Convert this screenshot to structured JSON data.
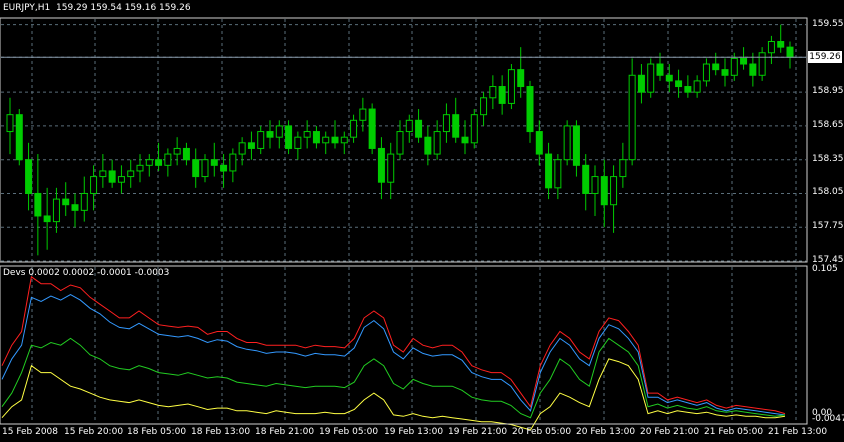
{
  "chart_header": {
    "symbol": "EURJPY,H1",
    "ohlc": "159.29 159.54 159.16 159.26"
  },
  "price_axis": {
    "ticks": [
      "159.55",
      "159.26",
      "158.95",
      "158.65",
      "158.35",
      "158.05",
      "157.75",
      "157.45"
    ],
    "current_price": "159.26"
  },
  "indicator": {
    "header": "Devs 0.0002 0.0002 -0.0001 -0.0003",
    "axis_ticks": [
      "0.105",
      "0.00",
      "-0.0047"
    ]
  },
  "time_axis": {
    "labels": [
      "15 Feb 2008",
      "15 Feb 20:00",
      "18 Feb 05:00",
      "18 Feb 13:00",
      "18 Feb 21:00",
      "19 Feb 05:00",
      "19 Feb 13:00",
      "19 Feb 21:00",
      "20 Feb 05:00",
      "20 Feb 13:00",
      "20 Feb 21:00",
      "21 Feb 05:00",
      "21 Feb 13:00"
    ]
  },
  "colors": {
    "background": "#000000",
    "grid": "#5a6e7a",
    "candle": "#00cc00",
    "price_line": "#8899aa",
    "dev1": "#ff2020",
    "dev2": "#3399ff",
    "dev3": "#22cc22",
    "dev4": "#ffff44"
  },
  "chart_data": {
    "type": "candlestick",
    "ylim": [
      157.45,
      159.6
    ],
    "candles": [
      [
        158.6,
        158.9,
        158.4,
        158.75
      ],
      [
        158.75,
        158.8,
        158.3,
        158.35
      ],
      [
        158.35,
        158.5,
        157.9,
        158.05
      ],
      [
        158.05,
        158.4,
        157.5,
        157.85
      ],
      [
        157.85,
        158.1,
        157.55,
        157.8
      ],
      [
        157.8,
        158.1,
        157.7,
        158.0
      ],
      [
        158.0,
        158.15,
        157.85,
        157.95
      ],
      [
        157.95,
        158.05,
        157.75,
        157.9
      ],
      [
        157.9,
        158.2,
        157.8,
        158.05
      ],
      [
        158.05,
        158.3,
        157.9,
        158.2
      ],
      [
        158.2,
        158.4,
        158.1,
        158.25
      ],
      [
        158.25,
        158.35,
        158.1,
        158.15
      ],
      [
        158.15,
        158.3,
        158.05,
        158.2
      ],
      [
        158.2,
        158.35,
        158.1,
        158.25
      ],
      [
        158.25,
        158.4,
        158.15,
        158.3
      ],
      [
        158.3,
        158.4,
        158.2,
        158.35
      ],
      [
        158.35,
        158.5,
        158.25,
        158.3
      ],
      [
        158.3,
        158.45,
        158.2,
        158.4
      ],
      [
        158.4,
        158.55,
        158.3,
        158.45
      ],
      [
        158.45,
        158.5,
        158.3,
        158.35
      ],
      [
        158.35,
        158.45,
        158.1,
        158.2
      ],
      [
        158.2,
        158.4,
        158.15,
        158.35
      ],
      [
        158.35,
        158.5,
        158.2,
        158.3
      ],
      [
        158.3,
        158.4,
        158.1,
        158.25
      ],
      [
        158.25,
        158.45,
        158.15,
        158.4
      ],
      [
        158.4,
        158.55,
        158.3,
        158.5
      ],
      [
        158.5,
        158.6,
        158.35,
        158.45
      ],
      [
        158.45,
        158.65,
        158.4,
        158.6
      ],
      [
        158.6,
        158.7,
        158.45,
        158.55
      ],
      [
        158.55,
        158.7,
        158.45,
        158.65
      ],
      [
        158.65,
        158.7,
        158.4,
        158.45
      ],
      [
        158.45,
        158.6,
        158.35,
        158.55
      ],
      [
        158.55,
        158.7,
        158.45,
        158.6
      ],
      [
        158.6,
        158.65,
        158.45,
        158.5
      ],
      [
        158.5,
        158.6,
        158.4,
        158.55
      ],
      [
        158.55,
        158.7,
        158.45,
        158.5
      ],
      [
        158.5,
        158.6,
        158.4,
        158.55
      ],
      [
        158.55,
        158.75,
        158.5,
        158.7
      ],
      [
        158.7,
        158.9,
        158.6,
        158.8
      ],
      [
        158.8,
        158.85,
        158.4,
        158.45
      ],
      [
        158.45,
        158.55,
        158.0,
        158.15
      ],
      [
        158.15,
        158.5,
        158.0,
        158.4
      ],
      [
        158.4,
        158.7,
        158.35,
        158.6
      ],
      [
        158.6,
        158.75,
        158.5,
        158.7
      ],
      [
        158.7,
        158.8,
        158.5,
        158.55
      ],
      [
        158.55,
        158.65,
        158.3,
        158.4
      ],
      [
        158.4,
        158.7,
        158.35,
        158.6
      ],
      [
        158.6,
        158.85,
        158.5,
        158.75
      ],
      [
        158.75,
        158.9,
        158.5,
        158.55
      ],
      [
        158.55,
        158.7,
        158.4,
        158.5
      ],
      [
        158.5,
        158.8,
        158.45,
        158.75
      ],
      [
        158.75,
        158.95,
        158.65,
        158.9
      ],
      [
        158.9,
        159.1,
        158.8,
        159.0
      ],
      [
        159.0,
        159.1,
        158.75,
        158.85
      ],
      [
        158.85,
        159.2,
        158.8,
        159.15
      ],
      [
        159.15,
        159.35,
        158.9,
        159.0
      ],
      [
        159.0,
        159.05,
        158.5,
        158.6
      ],
      [
        158.6,
        158.7,
        158.3,
        158.4
      ],
      [
        158.4,
        158.5,
        158.0,
        158.1
      ],
      [
        158.1,
        158.4,
        158.0,
        158.35
      ],
      [
        158.35,
        158.7,
        158.3,
        158.65
      ],
      [
        158.65,
        158.7,
        158.2,
        158.3
      ],
      [
        158.3,
        158.4,
        157.9,
        158.05
      ],
      [
        158.05,
        158.3,
        157.85,
        158.2
      ],
      [
        158.2,
        158.35,
        157.75,
        157.95
      ],
      [
        157.95,
        158.3,
        157.7,
        158.2
      ],
      [
        158.2,
        158.5,
        158.1,
        158.35
      ],
      [
        158.35,
        159.25,
        158.3,
        159.1
      ],
      [
        159.1,
        159.2,
        158.85,
        158.95
      ],
      [
        158.95,
        159.25,
        158.9,
        159.2
      ],
      [
        159.2,
        159.3,
        159.05,
        159.1
      ],
      [
        159.1,
        159.2,
        158.95,
        159.05
      ],
      [
        159.05,
        159.15,
        158.9,
        159.0
      ],
      [
        159.0,
        159.1,
        158.9,
        158.95
      ],
      [
        158.95,
        159.1,
        158.9,
        159.05
      ],
      [
        159.05,
        159.25,
        159.0,
        159.2
      ],
      [
        159.2,
        159.3,
        159.1,
        159.15
      ],
      [
        159.15,
        159.25,
        159.0,
        159.1
      ],
      [
        159.1,
        159.3,
        159.05,
        159.25
      ],
      [
        159.25,
        159.35,
        159.15,
        159.2
      ],
      [
        159.2,
        159.3,
        159.0,
        159.1
      ],
      [
        159.1,
        159.35,
        159.05,
        159.3
      ],
      [
        159.3,
        159.45,
        159.2,
        159.4
      ],
      [
        159.4,
        159.55,
        159.3,
        159.35
      ],
      [
        159.35,
        159.4,
        159.16,
        159.26
      ]
    ],
    "deviation": {
      "ylim": [
        -0.0047,
        0.105
      ],
      "series": [
        {
          "values": [
            0.035,
            0.05,
            0.06,
            0.1,
            0.095,
            0.095,
            0.09,
            0.094,
            0.092,
            0.085,
            0.08,
            0.075,
            0.07,
            0.07,
            0.075,
            0.07,
            0.065,
            0.064,
            0.063,
            0.064,
            0.063,
            0.058,
            0.06,
            0.06,
            0.055,
            0.052,
            0.052,
            0.05,
            0.05,
            0.05,
            0.05,
            0.048,
            0.05,
            0.049,
            0.049,
            0.048,
            0.055,
            0.07,
            0.075,
            0.07,
            0.05,
            0.045,
            0.055,
            0.05,
            0.048,
            0.05,
            0.05,
            0.045,
            0.035,
            0.032,
            0.03,
            0.03,
            0.025,
            0.015,
            0.005,
            0.035,
            0.05,
            0.06,
            0.055,
            0.045,
            0.04,
            0.06,
            0.07,
            0.068,
            0.06,
            0.05,
            0.015,
            0.015,
            0.01,
            0.012,
            0.01,
            0.008,
            0.01,
            0.006,
            0.004,
            0.006,
            0.005,
            0.004,
            0.003,
            0.002,
            0.0
          ]
        },
        {
          "values": [
            0.025,
            0.04,
            0.05,
            0.085,
            0.082,
            0.086,
            0.083,
            0.087,
            0.083,
            0.077,
            0.073,
            0.067,
            0.063,
            0.062,
            0.066,
            0.062,
            0.058,
            0.057,
            0.056,
            0.057,
            0.055,
            0.052,
            0.054,
            0.053,
            0.049,
            0.047,
            0.046,
            0.044,
            0.045,
            0.045,
            0.044,
            0.042,
            0.044,
            0.043,
            0.043,
            0.042,
            0.048,
            0.063,
            0.068,
            0.062,
            0.045,
            0.04,
            0.048,
            0.044,
            0.042,
            0.043,
            0.043,
            0.039,
            0.03,
            0.027,
            0.025,
            0.025,
            0.02,
            0.01,
            0.002,
            0.03,
            0.045,
            0.055,
            0.05,
            0.04,
            0.035,
            0.055,
            0.065,
            0.062,
            0.055,
            0.045,
            0.012,
            0.012,
            0.008,
            0.01,
            0.008,
            0.006,
            0.008,
            0.004,
            0.002,
            0.004,
            0.003,
            0.002,
            0.001,
            0.0,
            -0.001
          ]
        },
        {
          "values": [
            0.005,
            0.015,
            0.03,
            0.05,
            0.048,
            0.052,
            0.05,
            0.055,
            0.05,
            0.043,
            0.04,
            0.035,
            0.033,
            0.032,
            0.035,
            0.033,
            0.03,
            0.029,
            0.028,
            0.03,
            0.028,
            0.026,
            0.027,
            0.026,
            0.023,
            0.022,
            0.021,
            0.02,
            0.022,
            0.021,
            0.02,
            0.019,
            0.02,
            0.02,
            0.02,
            0.019,
            0.023,
            0.035,
            0.04,
            0.035,
            0.022,
            0.018,
            0.025,
            0.022,
            0.02,
            0.02,
            0.02,
            0.017,
            0.012,
            0.01,
            0.009,
            0.009,
            0.006,
            0.0,
            -0.003,
            0.015,
            0.025,
            0.04,
            0.035,
            0.025,
            0.02,
            0.045,
            0.055,
            0.05,
            0.045,
            0.035,
            0.005,
            0.007,
            0.004,
            0.006,
            0.004,
            0.003,
            0.005,
            0.002,
            0.001,
            0.002,
            0.001,
            0.0,
            -0.001,
            -0.002,
            -0.001
          ]
        },
        {
          "values": [
            -0.003,
            0.005,
            0.01,
            0.035,
            0.03,
            0.03,
            0.025,
            0.02,
            0.018,
            0.015,
            0.012,
            0.01,
            0.009,
            0.008,
            0.01,
            0.008,
            0.006,
            0.005,
            0.006,
            0.007,
            0.005,
            0.003,
            0.004,
            0.004,
            0.002,
            0.002,
            0.001,
            0.0,
            0.002,
            0.001,
            0.0,
            0.0,
            0.0,
            0.001,
            0.0,
            0.0,
            0.003,
            0.01,
            0.015,
            0.01,
            -0.001,
            -0.002,
            0.0,
            -0.002,
            -0.003,
            -0.002,
            -0.003,
            -0.004,
            -0.005,
            -0.006,
            -0.006,
            -0.007,
            -0.008,
            -0.01,
            -0.012,
            0.0,
            0.005,
            0.015,
            0.012,
            0.008,
            0.005,
            0.025,
            0.04,
            0.038,
            0.035,
            0.025,
            0.0,
            0.002,
            0.0,
            0.002,
            0.001,
            0.0,
            0.001,
            -0.001,
            -0.002,
            -0.001,
            -0.002,
            -0.002,
            -0.003,
            -0.003,
            -0.002
          ]
        }
      ]
    }
  }
}
